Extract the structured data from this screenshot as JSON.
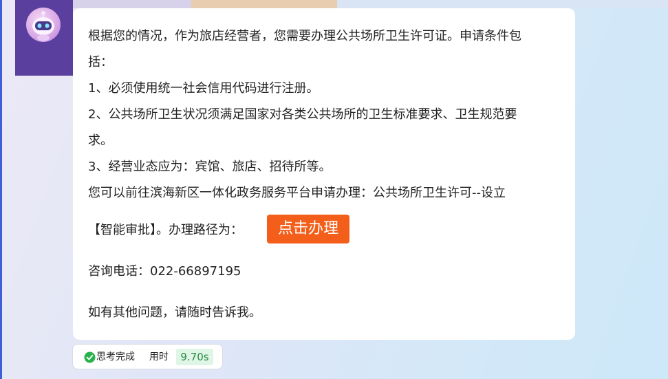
{
  "message": {
    "line1": "根据您的情况，作为旅店经营者，您需要办理公共场所卫生许可证。申请条件包",
    "line2": "括：",
    "line3": "1、必须使用统一社会信用代码进行注册。",
    "line4": "2、公共场所卫生状况须满足国家对各类公共场所的卫生标准要求、卫生规范要",
    "line5": "求。",
    "line6": "3、经营业态应为：宾馆、旅店、招待所等。",
    "line7": "您可以前往滨海新区一体化政务服务平台申请办理：公共场所卫生许可--设立",
    "line8": "【智能审批】。办理路径为：",
    "action_button": "点击办理",
    "phone": "咨询电话：022-66897195",
    "closing": "如有其他问题，请随时告诉我。"
  },
  "status": {
    "state": "思考完成",
    "time_label": "用时",
    "time_value": "9.70s",
    "accent": "#2bb24c"
  },
  "colors": {
    "action_button": "#f35f1b",
    "sidebar": "#5b3f9e"
  },
  "icons": {
    "avatar": "robot-avatar-icon",
    "status": "check-circle-icon"
  }
}
